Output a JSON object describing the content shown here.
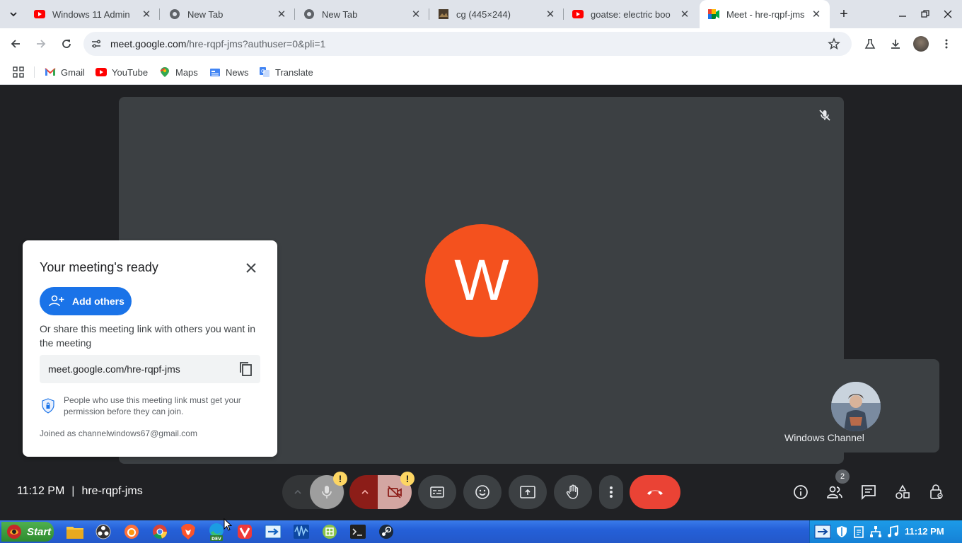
{
  "browser": {
    "tabs": [
      {
        "title": "Windows 11 Admin",
        "icon": "youtube-icon"
      },
      {
        "title": "New Tab",
        "icon": "chrome-icon"
      },
      {
        "title": "New Tab",
        "icon": "chrome-icon"
      },
      {
        "title": "cg (445×244)",
        "icon": "image-icon"
      },
      {
        "title": "goatse: electric boo",
        "icon": "youtube-icon"
      },
      {
        "title": "Meet - hre-rqpf-jms",
        "icon": "meet-icon",
        "active": true
      }
    ],
    "url_host": "meet.google.com",
    "url_rest": "/hre-rqpf-jms?authuser=0&pli=1",
    "bookmarks": [
      {
        "label": "Gmail",
        "icon": "gmail-icon"
      },
      {
        "label": "YouTube",
        "icon": "youtube-icon"
      },
      {
        "label": "Maps",
        "icon": "maps-icon"
      },
      {
        "label": "News",
        "icon": "news-icon"
      },
      {
        "label": "Translate",
        "icon": "translate-icon"
      }
    ]
  },
  "meet": {
    "main_participant_initial": "W",
    "self_name": "Windows Channel",
    "time": "11:12 PM",
    "meeting_code": "hre-rqpf-jms",
    "people_count": "2",
    "warning_badge": "!",
    "colors": {
      "avatar": "#f4511e",
      "end_call": "#ea4335",
      "primary": "#1a73e8"
    }
  },
  "popup": {
    "title": "Your meeting's ready",
    "add_others_label": "Add others",
    "share_text": "Or share this meeting link with others you want in the meeting",
    "link": "meet.google.com/hre-rqpf-jms",
    "permission_text": "People who use this meeting link must get your permission before they can join.",
    "joined_text": "Joined as channelwindows67@gmail.com"
  },
  "taskbar": {
    "start_label": "Start",
    "time": "11:12 PM"
  }
}
